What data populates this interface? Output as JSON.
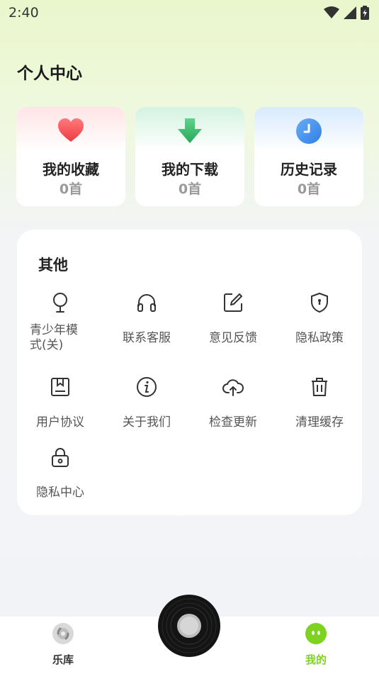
{
  "status": {
    "time": "2:40"
  },
  "page_title": "个人中心",
  "cards": [
    {
      "label": "我的收藏",
      "count": "0首",
      "icon": "heart-icon",
      "color": "#f0464a",
      "tint": "#ffe6e8"
    },
    {
      "label": "我的下载",
      "count": "0首",
      "icon": "download-arrow-icon",
      "color": "#3fbf6e",
      "tint": "#d8f5e4"
    },
    {
      "label": "历史记录",
      "count": "0首",
      "icon": "clock-icon",
      "color": "#3f8ef0",
      "tint": "#dcecfd"
    }
  ],
  "other": {
    "title": "其他",
    "items": [
      {
        "label": "青少年模式(关)",
        "label_line1": "青少年模",
        "label_line2": "式(关)",
        "icon": "teen-mode-icon"
      },
      {
        "label": "联系客服",
        "icon": "headphones-icon"
      },
      {
        "label": "意见反馈",
        "icon": "edit-icon"
      },
      {
        "label": "隐私政策",
        "icon": "shield-icon"
      },
      {
        "label": "用户协议",
        "icon": "agreement-icon"
      },
      {
        "label": "关于我们",
        "icon": "info-icon"
      },
      {
        "label": "检查更新",
        "icon": "cloud-upload-icon"
      },
      {
        "label": "清理缓存",
        "icon": "trash-icon"
      },
      {
        "label": "隐私中心",
        "icon": "lock-icon"
      }
    ]
  },
  "tabs": [
    {
      "label": "乐库",
      "icon": "music-library-icon",
      "active": false
    },
    {
      "label": "我的",
      "icon": "mine-face-icon",
      "active": true
    }
  ],
  "colors": {
    "accent": "#7ed321",
    "inactive_tab": "#333333",
    "icon_stroke": "#333333"
  }
}
